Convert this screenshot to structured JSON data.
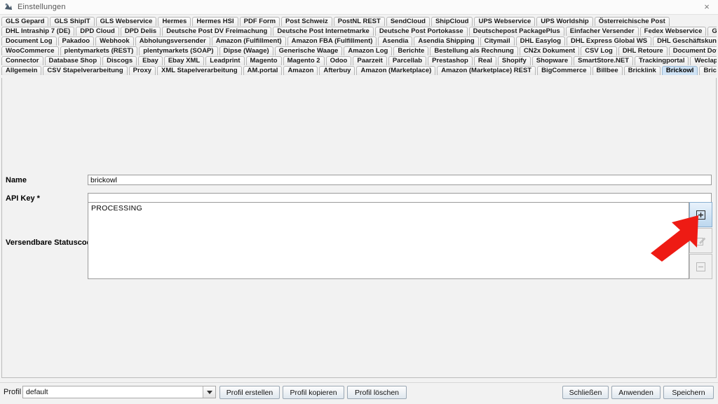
{
  "window": {
    "title": "Einstellungen",
    "icon": "app-icon",
    "close_label": "×"
  },
  "tabs": {
    "selected": "Brickowl",
    "rows": [
      [
        "GLS Gepard",
        "GLS ShipIT",
        "GLS Webservice",
        "Hermes",
        "Hermes HSI",
        "PDF Form",
        "Post Schweiz",
        "PostNL REST",
        "SendCloud",
        "ShipCloud",
        "UPS Webservice",
        "UPS Worldship",
        "Österreichische Post"
      ],
      [
        "DHL Intraship 7 (DE)",
        "DPD Cloud",
        "DPD Delis",
        "Deutsche Post DV Freimachung",
        "Deutsche Post Internetmarke",
        "Deutsche Post Portokasse",
        "Deutschepost PackagePlus",
        "Einfacher Versender",
        "Fedex Webservice",
        "GEL Express"
      ],
      [
        "Document Log",
        "Pakadoo",
        "Webhook",
        "Abholungsversender",
        "Amazon (Fulfillment)",
        "Amazon FBA (Fulfillment)",
        "Asendia",
        "Asendia Shipping",
        "Citymail",
        "DHL Easylog",
        "DHL Express Global WS",
        "DHL Geschäftskundenversand"
      ],
      [
        "WooCommerce",
        "plentymarkets (REST)",
        "plentymarkets (SOAP)",
        "Dipse (Waage)",
        "Generische Waage",
        "Amazon Log",
        "Berichte",
        "Bestellung als Rechnung",
        "CN2x Dokument",
        "CSV Log",
        "DHL Retoure",
        "Document Downloader"
      ],
      [
        "Connector",
        "Database Shop",
        "Discogs",
        "Ebay",
        "Ebay XML",
        "Leadprint",
        "Magento",
        "Magento 2",
        "Odoo",
        "Paarzeit",
        "Parcellab",
        "Prestashop",
        "Real",
        "Shopify",
        "Shopware",
        "SmartStore.NET",
        "Trackingportal",
        "Weclapp"
      ],
      [
        "Allgemein",
        "CSV Stapelverarbeitung",
        "Proxy",
        "XML Stapelverarbeitung",
        "AM.portal",
        "Amazon",
        "Afterbuy",
        "Amazon (Marketplace)",
        "Amazon (Marketplace) REST",
        "BigCommerce",
        "Billbee",
        "Bricklink",
        "Brickowl",
        "Brickscout"
      ]
    ]
  },
  "form": {
    "name_label": "Name",
    "name_value": "brickowl",
    "api_key_label": "API Key *",
    "api_key_value": "",
    "status_codes_label": "Versendbare Statuscodes *",
    "status_codes_items": [
      "PROCESSING"
    ],
    "side_buttons": [
      {
        "name": "add-status-code-button",
        "glyph": "⊞",
        "state": "active"
      },
      {
        "name": "edit-status-code-button",
        "glyph": "✎",
        "state": "disabled"
      },
      {
        "name": "remove-status-code-button",
        "glyph": "⊟",
        "state": "disabled"
      }
    ]
  },
  "footer": {
    "profile_label": "Profil",
    "profile_value": "default",
    "create_profile": "Profil erstellen",
    "copy_profile": "Profil kopieren",
    "delete_profile": "Profil löschen",
    "close": "Schließen",
    "apply": "Anwenden",
    "save": "Speichern"
  },
  "annotation": {
    "arrow_color": "#ee1b14",
    "arrow_points_to": "add-status-code-button"
  }
}
